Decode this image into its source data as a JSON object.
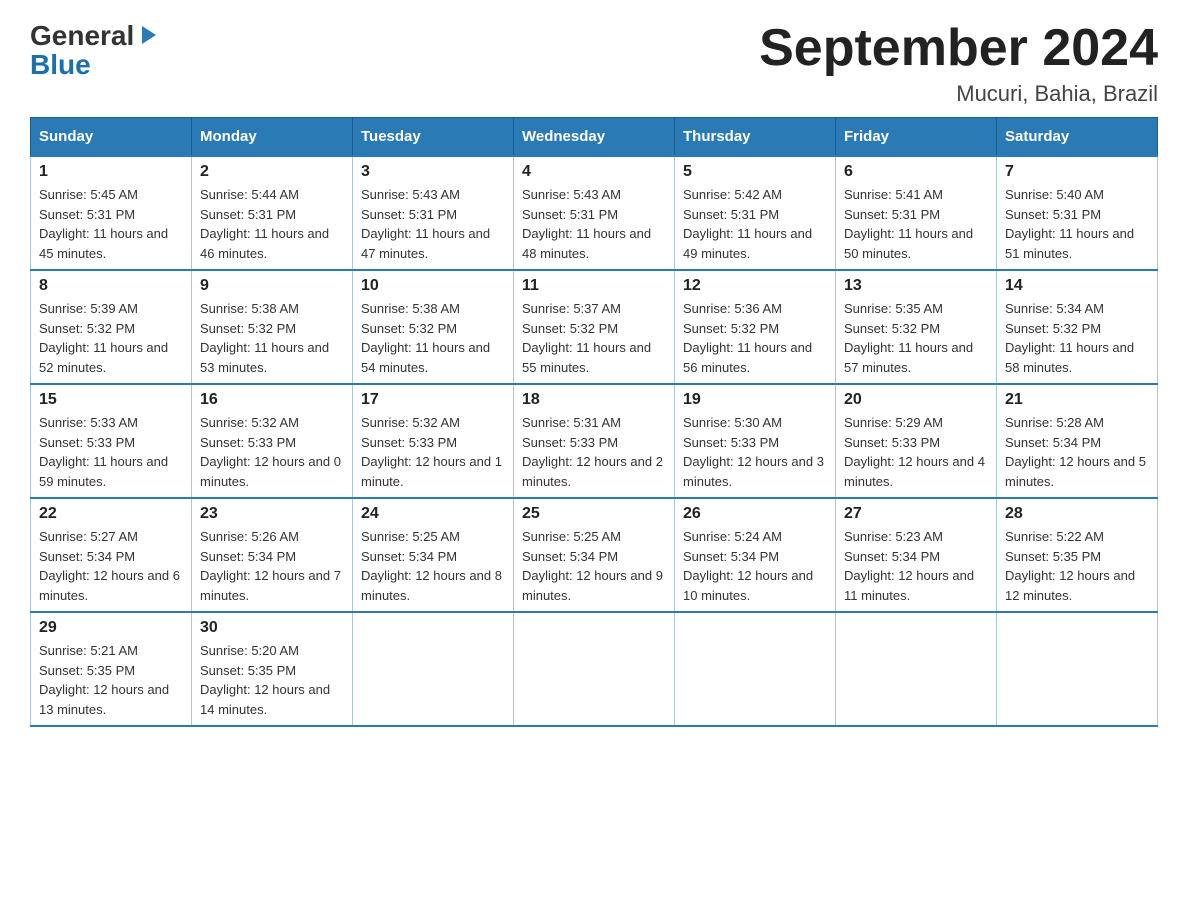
{
  "logo": {
    "general": "General",
    "blue": "Blue",
    "arrow": "▶"
  },
  "title": "September 2024",
  "location": "Mucuri, Bahia, Brazil",
  "weekdays": [
    "Sunday",
    "Monday",
    "Tuesday",
    "Wednesday",
    "Thursday",
    "Friday",
    "Saturday"
  ],
  "weeks": [
    [
      {
        "day": 1,
        "sunrise": "5:45 AM",
        "sunset": "5:31 PM",
        "daylight": "11 hours and 45 minutes."
      },
      {
        "day": 2,
        "sunrise": "5:44 AM",
        "sunset": "5:31 PM",
        "daylight": "11 hours and 46 minutes."
      },
      {
        "day": 3,
        "sunrise": "5:43 AM",
        "sunset": "5:31 PM",
        "daylight": "11 hours and 47 minutes."
      },
      {
        "day": 4,
        "sunrise": "5:43 AM",
        "sunset": "5:31 PM",
        "daylight": "11 hours and 48 minutes."
      },
      {
        "day": 5,
        "sunrise": "5:42 AM",
        "sunset": "5:31 PM",
        "daylight": "11 hours and 49 minutes."
      },
      {
        "day": 6,
        "sunrise": "5:41 AM",
        "sunset": "5:31 PM",
        "daylight": "11 hours and 50 minutes."
      },
      {
        "day": 7,
        "sunrise": "5:40 AM",
        "sunset": "5:31 PM",
        "daylight": "11 hours and 51 minutes."
      }
    ],
    [
      {
        "day": 8,
        "sunrise": "5:39 AM",
        "sunset": "5:32 PM",
        "daylight": "11 hours and 52 minutes."
      },
      {
        "day": 9,
        "sunrise": "5:38 AM",
        "sunset": "5:32 PM",
        "daylight": "11 hours and 53 minutes."
      },
      {
        "day": 10,
        "sunrise": "5:38 AM",
        "sunset": "5:32 PM",
        "daylight": "11 hours and 54 minutes."
      },
      {
        "day": 11,
        "sunrise": "5:37 AM",
        "sunset": "5:32 PM",
        "daylight": "11 hours and 55 minutes."
      },
      {
        "day": 12,
        "sunrise": "5:36 AM",
        "sunset": "5:32 PM",
        "daylight": "11 hours and 56 minutes."
      },
      {
        "day": 13,
        "sunrise": "5:35 AM",
        "sunset": "5:32 PM",
        "daylight": "11 hours and 57 minutes."
      },
      {
        "day": 14,
        "sunrise": "5:34 AM",
        "sunset": "5:32 PM",
        "daylight": "11 hours and 58 minutes."
      }
    ],
    [
      {
        "day": 15,
        "sunrise": "5:33 AM",
        "sunset": "5:33 PM",
        "daylight": "11 hours and 59 minutes."
      },
      {
        "day": 16,
        "sunrise": "5:32 AM",
        "sunset": "5:33 PM",
        "daylight": "12 hours and 0 minutes."
      },
      {
        "day": 17,
        "sunrise": "5:32 AM",
        "sunset": "5:33 PM",
        "daylight": "12 hours and 1 minute."
      },
      {
        "day": 18,
        "sunrise": "5:31 AM",
        "sunset": "5:33 PM",
        "daylight": "12 hours and 2 minutes."
      },
      {
        "day": 19,
        "sunrise": "5:30 AM",
        "sunset": "5:33 PM",
        "daylight": "12 hours and 3 minutes."
      },
      {
        "day": 20,
        "sunrise": "5:29 AM",
        "sunset": "5:33 PM",
        "daylight": "12 hours and 4 minutes."
      },
      {
        "day": 21,
        "sunrise": "5:28 AM",
        "sunset": "5:34 PM",
        "daylight": "12 hours and 5 minutes."
      }
    ],
    [
      {
        "day": 22,
        "sunrise": "5:27 AM",
        "sunset": "5:34 PM",
        "daylight": "12 hours and 6 minutes."
      },
      {
        "day": 23,
        "sunrise": "5:26 AM",
        "sunset": "5:34 PM",
        "daylight": "12 hours and 7 minutes."
      },
      {
        "day": 24,
        "sunrise": "5:25 AM",
        "sunset": "5:34 PM",
        "daylight": "12 hours and 8 minutes."
      },
      {
        "day": 25,
        "sunrise": "5:25 AM",
        "sunset": "5:34 PM",
        "daylight": "12 hours and 9 minutes."
      },
      {
        "day": 26,
        "sunrise": "5:24 AM",
        "sunset": "5:34 PM",
        "daylight": "12 hours and 10 minutes."
      },
      {
        "day": 27,
        "sunrise": "5:23 AM",
        "sunset": "5:34 PM",
        "daylight": "12 hours and 11 minutes."
      },
      {
        "day": 28,
        "sunrise": "5:22 AM",
        "sunset": "5:35 PM",
        "daylight": "12 hours and 12 minutes."
      }
    ],
    [
      {
        "day": 29,
        "sunrise": "5:21 AM",
        "sunset": "5:35 PM",
        "daylight": "12 hours and 13 minutes."
      },
      {
        "day": 30,
        "sunrise": "5:20 AM",
        "sunset": "5:35 PM",
        "daylight": "12 hours and 14 minutes."
      },
      null,
      null,
      null,
      null,
      null
    ]
  ],
  "labels": {
    "sunrise": "Sunrise:",
    "sunset": "Sunset:",
    "daylight": "Daylight:"
  }
}
